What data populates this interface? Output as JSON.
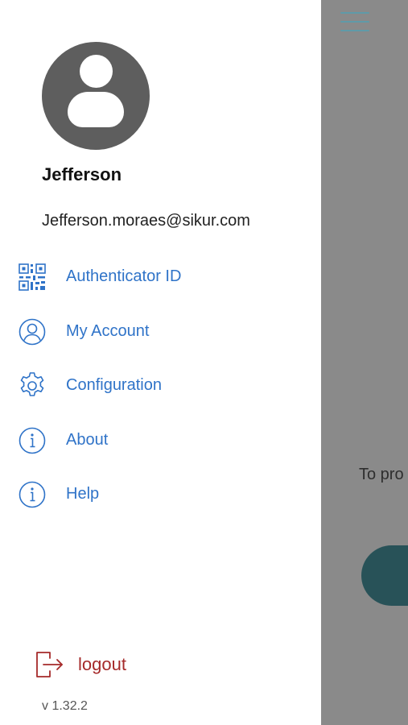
{
  "user": {
    "name": "Jefferson",
    "email": "Jefferson.moraes@sikur.com"
  },
  "menu": [
    {
      "label": "Authenticator ID",
      "icon": "qr-code-icon"
    },
    {
      "label": "My Account",
      "icon": "user-circle-icon"
    },
    {
      "label": "Configuration",
      "icon": "gear-icon"
    },
    {
      "label": "About",
      "icon": "info-icon"
    },
    {
      "label": "Help",
      "icon": "info-icon"
    }
  ],
  "logout": {
    "label": "logout",
    "icon": "logout-icon"
  },
  "version": "v 1.32.2",
  "background": {
    "partial_text": "To pro"
  },
  "colors": {
    "accent": "#2f73c8",
    "logout": "#a52a2a",
    "avatar": "#5e5e5e",
    "overlay": "#8a8a8a",
    "bg_button": "#285258"
  }
}
